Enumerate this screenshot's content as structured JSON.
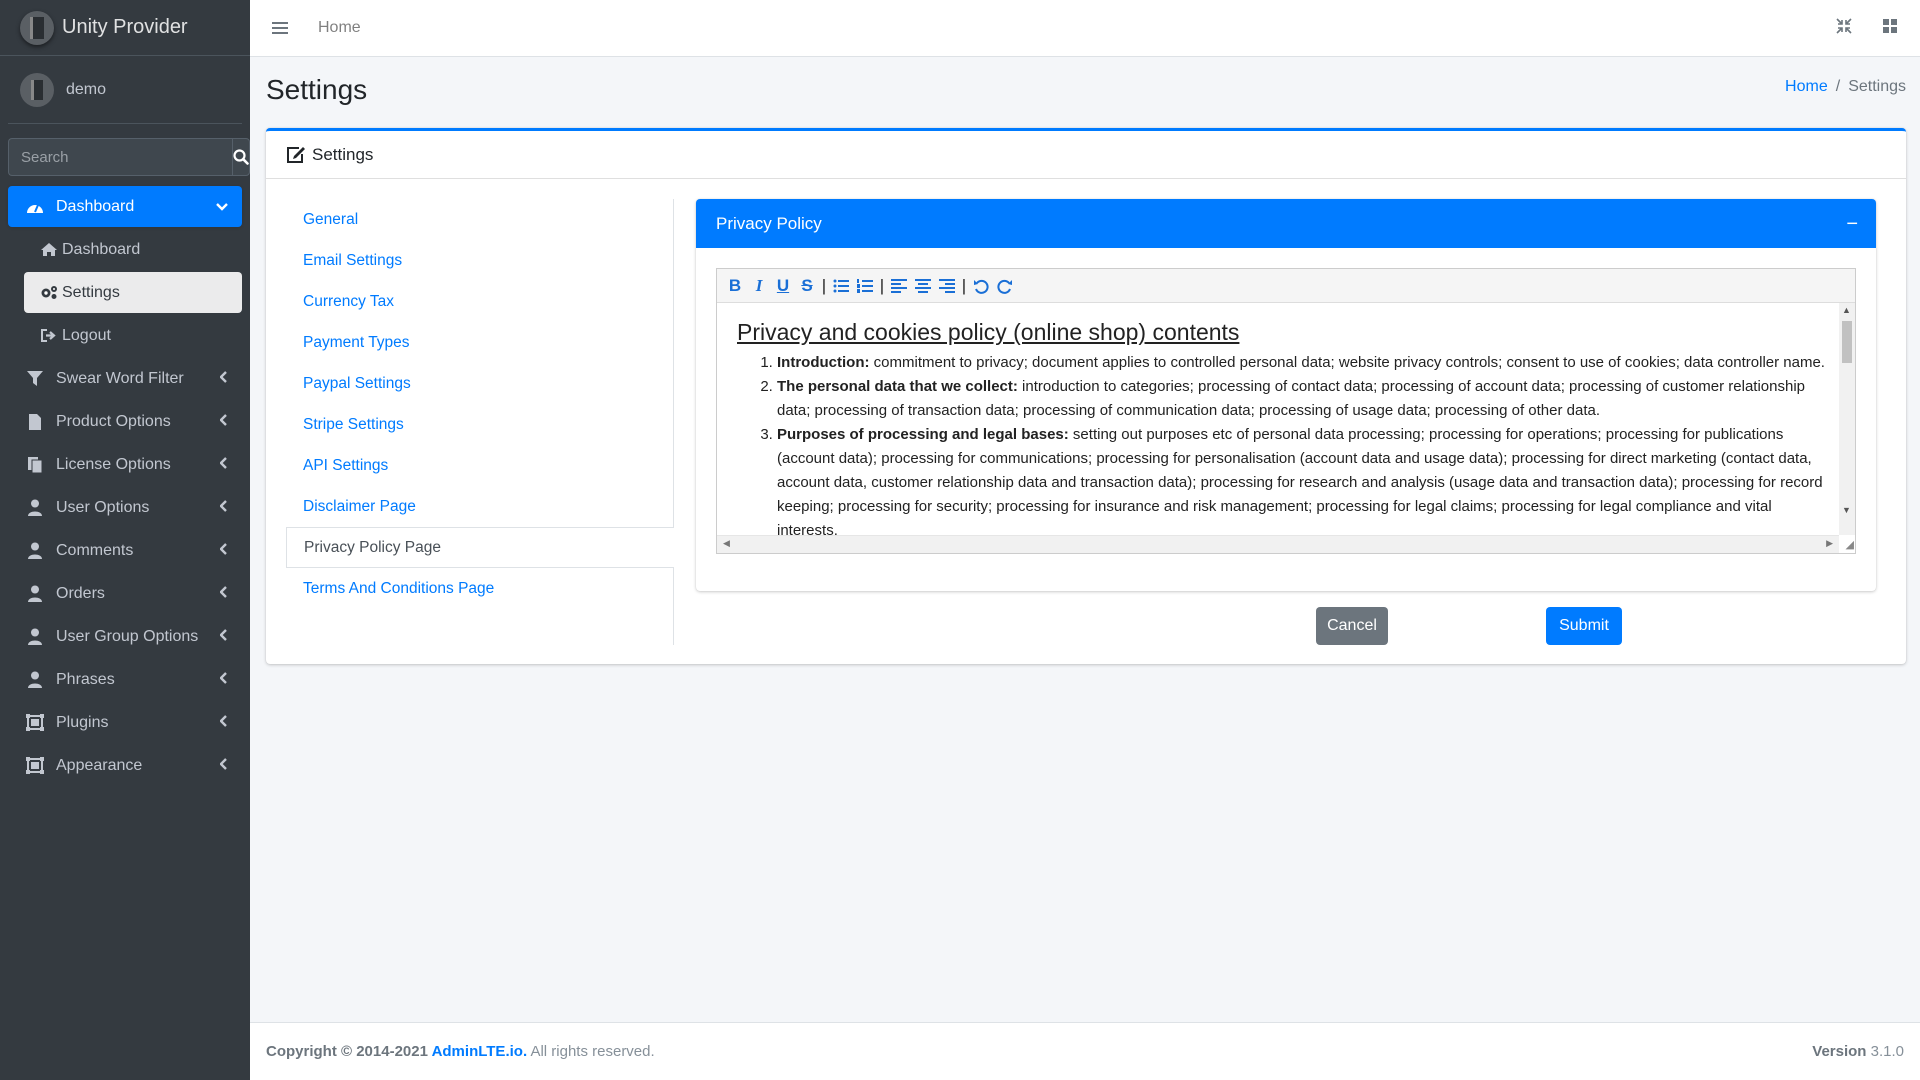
{
  "brand": {
    "name": "Unity Provider"
  },
  "user": {
    "name": "demo"
  },
  "search": {
    "placeholder": "Search"
  },
  "sidebar": {
    "dashboard_group": "Dashboard",
    "sub": [
      {
        "label": "Dashboard",
        "icon": "home-icon"
      },
      {
        "label": "Settings",
        "icon": "gears-icon"
      },
      {
        "label": "Logout",
        "icon": "sign-out-icon"
      }
    ],
    "items": [
      {
        "label": "Swear Word Filter",
        "icon": "filter-icon"
      },
      {
        "label": "Product Options",
        "icon": "file-icon"
      },
      {
        "label": "License Options",
        "icon": "copy-icon"
      },
      {
        "label": "User Options",
        "icon": "user-icon"
      },
      {
        "label": "Comments",
        "icon": "user-icon"
      },
      {
        "label": "Orders",
        "icon": "user-icon"
      },
      {
        "label": "User Group Options",
        "icon": "user-icon"
      },
      {
        "label": "Phrases",
        "icon": "user-icon"
      },
      {
        "label": "Plugins",
        "icon": "object-group-icon"
      },
      {
        "label": "Appearance",
        "icon": "object-group-icon"
      }
    ]
  },
  "topbar": {
    "home": "Home"
  },
  "header": {
    "title": "Settings",
    "breadcrumb_home": "Home",
    "breadcrumb_current": "Settings"
  },
  "card": {
    "title": "Settings"
  },
  "settings_nav": [
    "General",
    "Email Settings",
    "Currency Tax",
    "Payment Types",
    "Paypal Settings",
    "Stripe Settings",
    "API Settings",
    "Disclaimer Page",
    "Privacy Policy Page",
    "Terms And Conditions Page"
  ],
  "panel": {
    "title": "Privacy Policy",
    "collapse_symbol": "−"
  },
  "editor": {
    "heading": "Privacy and cookies policy (online shop) contents",
    "items": [
      {
        "bold": "Introduction:",
        "text": " commitment to privacy; document applies to controlled personal data; website privacy controls; consent to use of cookies; data controller name."
      },
      {
        "bold": "The personal data that we collect:",
        "text": " introduction to categories; processing of contact data; processing of account data; processing of customer relationship data; processing of transaction data; processing of communication data; processing of usage data; processing of other data."
      },
      {
        "bold": "Purposes of processing and legal bases:",
        "text": " setting out purposes etc of personal data processing; processing for operations; processing for publications (account data); processing for communications; processing for personalisation (account data and usage data); processing for direct marketing (contact data, account data, customer relationship data and transaction data); processing for research and analysis (usage data and transaction data); processing for record keeping; processing for security; processing for insurance and risk management; processing for legal claims; processing for legal compliance and vital interests."
      }
    ]
  },
  "buttons": {
    "cancel": "Cancel",
    "submit": "Submit"
  },
  "footer": {
    "copyright": "Copyright © 2014-2021 ",
    "link": "AdminLTE.io.",
    "rights": " All rights reserved.",
    "version_label": "Version",
    "version": " 3.1.0"
  },
  "colors": {
    "primary": "#007bff",
    "sidebar": "#343a40",
    "secondary": "#6c757d"
  }
}
